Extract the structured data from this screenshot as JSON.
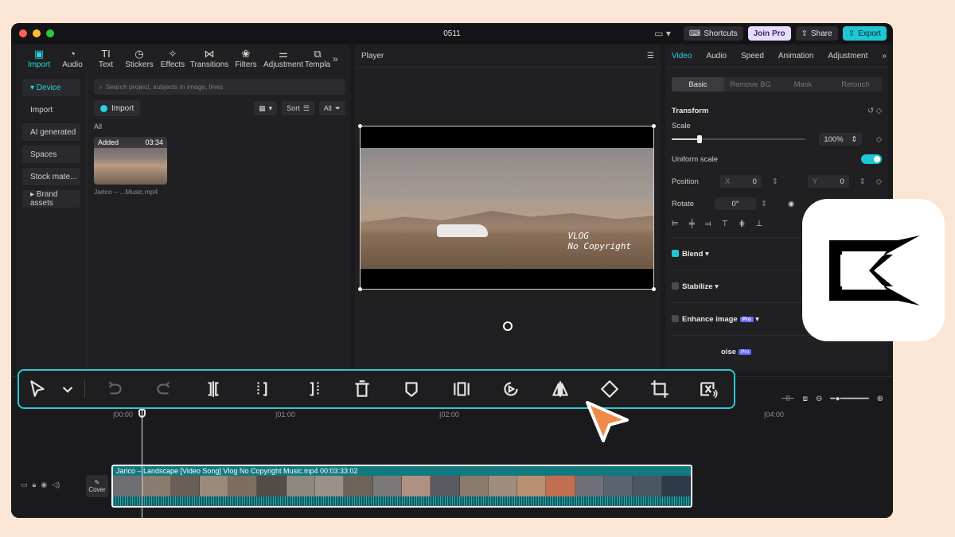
{
  "window": {
    "title": "0511",
    "buttons": {
      "shortcuts": "Shortcuts",
      "join_pro": "Join Pro",
      "share": "Share",
      "export": "Export"
    },
    "colors": {
      "accent": "#1ec7d3",
      "background": "#fbe6d6"
    }
  },
  "media_tabs": [
    {
      "label": "Import",
      "icon": "import-icon"
    },
    {
      "label": "Audio",
      "icon": "audio-icon"
    },
    {
      "label": "Text",
      "icon": "text-icon"
    },
    {
      "label": "Stickers",
      "icon": "stickers-icon"
    },
    {
      "label": "Effects",
      "icon": "effects-icon"
    },
    {
      "label": "Transitions",
      "icon": "transitions-icon"
    },
    {
      "label": "Filters",
      "icon": "filters-icon"
    },
    {
      "label": "Adjustment",
      "icon": "adjustment-icon"
    },
    {
      "label": "Templa",
      "icon": "templates-icon"
    }
  ],
  "sidebar": {
    "items": [
      {
        "label": "▾ Device"
      },
      {
        "label": "Import"
      },
      {
        "label": "AI generated"
      },
      {
        "label": "Spaces"
      },
      {
        "label": "Stock mate..."
      },
      {
        "label": "▸ Brand assets"
      }
    ]
  },
  "media": {
    "search_placeholder": "Search project, subjects in image, lines",
    "import_label": "Import",
    "sort_label": "Sort",
    "filter_label": "All",
    "section_label": "All",
    "clip": {
      "badge": "Added",
      "duration": "03:34",
      "filename": "Jarico – ...Music.mp4"
    }
  },
  "player": {
    "title": "Player",
    "overlay_text_1": "VLOG",
    "overlay_text_2": "No Copyright"
  },
  "inspector": {
    "tabs": [
      "Video",
      "Audio",
      "Speed",
      "Animation",
      "Adjustment"
    ],
    "subtabs": [
      "Basic",
      "Remove BG",
      "Mask",
      "Retouch"
    ],
    "transform_label": "Transform",
    "scale_label": "Scale",
    "scale_value": "100%",
    "uniform_scale_label": "Uniform scale",
    "position_label": "Position",
    "pos_x_label": "X",
    "pos_x_value": "0",
    "pos_y_label": "Y",
    "pos_y_value": "0",
    "rotate_label": "Rotate",
    "rotate_value": "0°",
    "blend_label": "Blend",
    "stabilize_label": "Stabilize",
    "enhance_label": "Enhance image",
    "pro_badge": "Pro",
    "denoise_label": "oise"
  },
  "timeline": {
    "ruler": [
      "|00:00",
      "|01:00",
      "|02:00",
      "|04:00"
    ],
    "cover_label": "Cover",
    "clip_label": "Jarico – Landscape [Video Song] Vlog No Copyright Music.mp4   00:03:33:02"
  },
  "toolbar": {
    "tools": [
      {
        "name": "select-tool",
        "icon": "pointer-icon"
      },
      {
        "name": "select-dropdown",
        "icon": "chevron-down-icon"
      },
      {
        "name": "undo",
        "icon": "undo-icon"
      },
      {
        "name": "redo",
        "icon": "redo-icon"
      },
      {
        "name": "split",
        "icon": "split-icon"
      },
      {
        "name": "delete-left",
        "icon": "trim-left-icon"
      },
      {
        "name": "delete-right",
        "icon": "trim-right-icon"
      },
      {
        "name": "delete",
        "icon": "delete-icon"
      },
      {
        "name": "mark",
        "icon": "marker-icon"
      },
      {
        "name": "freeze",
        "icon": "freeze-icon"
      },
      {
        "name": "reverse",
        "icon": "reverse-icon"
      },
      {
        "name": "mirror",
        "icon": "mirror-icon"
      },
      {
        "name": "rotate",
        "icon": "rotate-icon"
      },
      {
        "name": "crop",
        "icon": "crop-icon"
      },
      {
        "name": "remove-bg",
        "icon": "cutout-icon"
      }
    ]
  },
  "brand": {
    "logo_icon": "capcut-logo-icon"
  }
}
